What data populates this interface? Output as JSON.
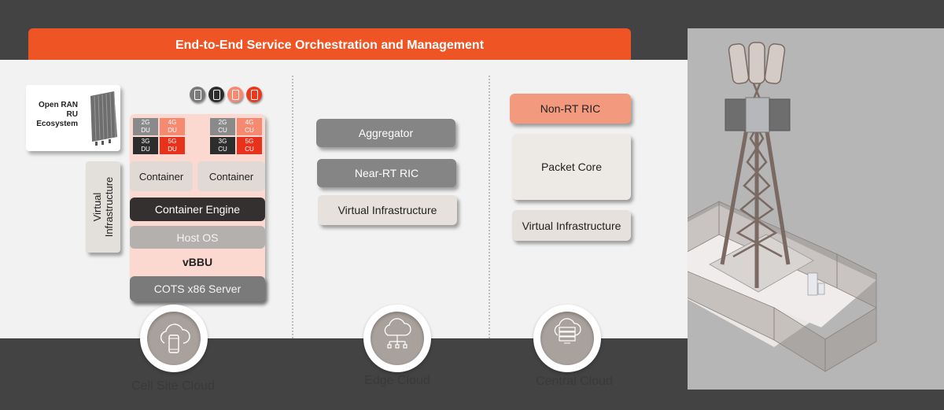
{
  "banner": {
    "title": "End-to-End Service Orchestration and Management"
  },
  "colors": {
    "accent": "#ef5524",
    "dark": "#434343",
    "light": "#f2f2f2",
    "salmon": "#f39a7e",
    "red": "#e8321b",
    "gray": "#858585",
    "beige": "#ede9e5"
  },
  "cell_site": {
    "ru_card": {
      "label_lines": [
        "Open RAN",
        "RU",
        "Ecosystem"
      ],
      "icon": "radio-unit-icon"
    },
    "device_icons": [
      {
        "name": "phone-2g-icon",
        "color": "#7a7a7a"
      },
      {
        "name": "phone-3g-icon",
        "color": "#2d2d2d"
      },
      {
        "name": "phone-4g-icon",
        "color": "#f58a70"
      },
      {
        "name": "phone-5g-icon",
        "color": "#ea3a1e"
      }
    ],
    "du_cells": [
      {
        "top": "2G",
        "bottom": "DU",
        "color": "#8a8a8a"
      },
      {
        "top": "4G",
        "bottom": "DU",
        "color": "#f58a70"
      },
      {
        "top": "3G",
        "bottom": "DU",
        "color": "#2d2d2d"
      },
      {
        "top": "5G",
        "bottom": "DU",
        "color": "#e8321b"
      }
    ],
    "cu_cells": [
      {
        "top": "2G",
        "bottom": "CU",
        "color": "#8a8a8a"
      },
      {
        "top": "4G",
        "bottom": "CU",
        "color": "#f58a70"
      },
      {
        "top": "3G",
        "bottom": "CU",
        "color": "#2d2d2d"
      },
      {
        "top": "5G",
        "bottom": "CU",
        "color": "#e8321b"
      }
    ],
    "containers": [
      "Container",
      "Container"
    ],
    "container_engine": "Container Engine",
    "host_os": "Host OS",
    "vbbu": "vBBU",
    "server": "COTS x86 Server",
    "virtual_infra_lines": [
      "Virtual",
      "Infrastructure"
    ],
    "cloud_label": "Cell Site Cloud",
    "cloud_icon": "cloud-mobile-icon"
  },
  "edge": {
    "boxes": [
      "Aggregator",
      "Near-RT RIC",
      "Virtual Infrastructure"
    ],
    "cloud_label": "Edge Cloud",
    "cloud_icon": "cloud-network-icon"
  },
  "central": {
    "boxes": [
      "Non-RT RIC",
      "Packet Core",
      "Virtual Infrastructure"
    ],
    "cloud_label": "Central Cloud",
    "cloud_icon": "cloud-server-icon"
  },
  "illustration": {
    "name": "cell-tower-illustration"
  }
}
